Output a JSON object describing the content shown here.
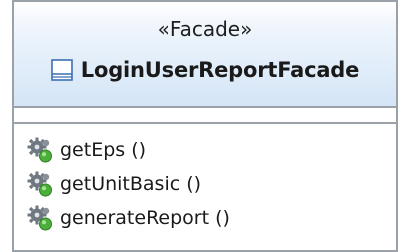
{
  "class": {
    "stereotype": "«Facade»",
    "name": "LoginUserReportFacade",
    "icon": "class-icon",
    "operations": [
      {
        "label": "getEps ()",
        "icon": "operation-gears-icon"
      },
      {
        "label": "getUnitBasic ()",
        "icon": "operation-gears-icon"
      },
      {
        "label": "generateReport ()",
        "icon": "operation-gears-icon"
      }
    ]
  },
  "colors": {
    "border": "#9aa1a8",
    "header_gradient_top": "#ffffff",
    "header_gradient_bottom": "#d4e5f7",
    "icon_blue": "#3d6fb4",
    "gear_gray": "#6f7780",
    "gear_green": "#4caf3a"
  }
}
